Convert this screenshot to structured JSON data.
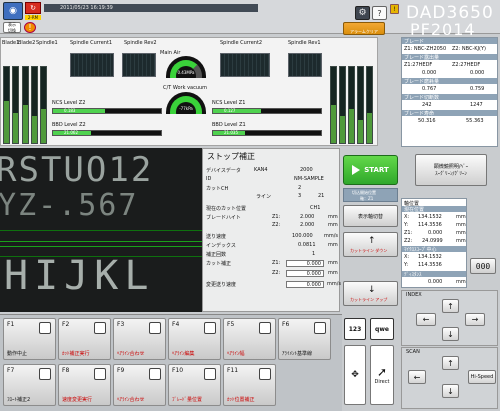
{
  "header": {
    "timestamp": "2011/05/23 16:19:39",
    "alarm_label": "2-RM",
    "dad_title": "DAD3650",
    "pf_title": "PF2014",
    "mini_button_1": "表示",
    "mini_button_2": "切換",
    "alarm_clear_label": "アラームクリア",
    "warn_label": "！"
  },
  "meters": {
    "spindle_names": [
      "Blade1",
      "Blade2",
      "Spindle Current1",
      "Spindle Rev2",
      "Spindle Current2",
      "Spindle Rev1",
      "NCS Level",
      "NCS Level2",
      "BBD Level"
    ],
    "titles": {
      "bh1": "Blade1",
      "bh2": "Blade2",
      "sp1": "Spindle1",
      "sc1": "Spindle Current1",
      "sr2": "Spindle Rev2",
      "air": "Main Air",
      "sc2": "Spindle Current2",
      "sr1": "Spindle Rev1",
      "cwt": "C/T Work vacuum",
      "ncs2": "NCS Level Z2",
      "ncs1": "NCS Level Z1",
      "bbd2": "BBD Level Z2",
      "bbd1": "BBD Level Z1",
      "gauge_top": "0.43MPa",
      "gauge_bot": "-77kPa"
    },
    "bbd_value_left": "21.062",
    "bbd_value_right": "21.035",
    "ncs_value_left": "0.183",
    "ncs_value_right": "0.127"
  },
  "main_panel": {
    "title": "ストップ補正",
    "device_data_label": "デバイスデータ",
    "device_data_value": "KAN4",
    "device_data_count": "2000",
    "id_label": "ID",
    "id_value": "NM-SAMPLE",
    "cut_ch_label": "カットCH",
    "ch_label": "ライン",
    "ch_value": "2",
    "line_value": "3",
    "line_total": "21",
    "current_ch": "CH1",
    "pos_label": "現在のカット位置",
    "blade_height_label": "ブレードハイト",
    "z1": "Z1:",
    "z2": "Z2:",
    "z1_blade_height": "2.000",
    "z2_blade_height": "2.000",
    "feed_speed_label": "送り速度",
    "feed_speed_value": "100.000",
    "unit_feed": "mm/s",
    "index_label": "インデックス",
    "index_value": "0.0811",
    "unit_mm": "mm",
    "repeat_label": "補正回数",
    "repeat_value": "1",
    "offset_label": "カット補正",
    "offset_z1": "0.000",
    "offset_z2": "0.000",
    "change_speed_label": "変更送り速度",
    "change_speed_value": "0.000",
    "unit_speed2": "mm/s"
  },
  "side_buttons": {
    "start": "START",
    "start_hint": "切込開始位置",
    "cut_hint_axis": "軸：Z1",
    "display_toggle": "表示軸切替",
    "cutline_down": "カットライン ダウン",
    "cutline_up": "カットライン アップ"
  },
  "right_panel": {
    "sec_blade": "ブレード",
    "blade_z1": "Z1: NBC-ZH2050",
    "blade_z2": "Z2: NBC-KJ(Y)",
    "sec_exposure": "ブレード露出量",
    "z1_id": "Z1:27HEDF",
    "z2_id": "Z2:27HEDF",
    "exp_z1": "0.000",
    "exp_z2": "0.000",
    "sec_wear": "ブレード磨耗量",
    "wear_z1": "0.767",
    "wear_z2": "0.759",
    "sec_cutcount": "ブレード切断数",
    "cut_z1": "242",
    "cut_z2": "1247",
    "sec_life": "ブレード寿命",
    "life_z1": "50.316",
    "life_z2": "55.363",
    "unit_mm": "mm",
    "unit_line": "本"
  },
  "microscope_btn": {
    "line1": "顕微鏡照明/ﾍﾞｰ",
    "line2": "ｽｰｸﾞﾘｰﾝ/ｸﾞﾘｰﾝ"
  },
  "axis_panel": {
    "title": "軸位置",
    "sec_current": "現在位置",
    "x_label": "X:",
    "x_value": "134.1532",
    "y_label": "Y:",
    "y_value": "114.3536",
    "z1_label": "Z1:",
    "z1_value": "0.000",
    "z2_label": "Z2:",
    "z2_value": "24.0999",
    "sec_mic": "ﾏｲｸﾛｽｺｰﾌﾟ中心",
    "mx_value": "134.1532",
    "my_value": "114.3536",
    "sec_offset": "ﾃﾞｨｽﾀﾝｽ",
    "off_value": "0.000",
    "unit": "mm",
    "counter": "000"
  },
  "index_panel": {
    "title": "INDEX"
  },
  "scan_panel": {
    "title": "SCAN",
    "hi_speed": "Hi-Speed"
  },
  "fkeys": [
    {
      "key": "F1",
      "label": "動作中止",
      "dark": true
    },
    {
      "key": "F2",
      "label": "ｶｯﾄ補正実行",
      "dark": false
    },
    {
      "key": "F3",
      "label": "ﾍｱﾗｲﾝ合わせ",
      "dark": false
    },
    {
      "key": "F4",
      "label": "ﾍｱﾗｲﾝ編集",
      "dark": false
    },
    {
      "key": "F5",
      "label": "ﾍｱﾗｲﾝ幅",
      "dark": false
    },
    {
      "key": "F6",
      "label": "ｱﾗｲﾒﾝﾄ基準線",
      "dark": true
    },
    {
      "key": "F7",
      "label": "ﾌﾛｰﾄ補正2",
      "dark": true
    },
    {
      "key": "F8",
      "label": "速度変更実行",
      "dark": false
    },
    {
      "key": "F9",
      "label": "ﾍｱﾗｲﾝ合わせ",
      "dark": false
    },
    {
      "key": "F10",
      "label": "ﾌﾞﾚｰﾄﾞ量位置",
      "dark": false
    },
    {
      "key": "F11",
      "label": "ｶｯﾄ位置補正",
      "dark": false
    }
  ],
  "bottom_right": {
    "btn_123": "123",
    "btn_qwe": "qwe",
    "btn_direct": "Direct"
  },
  "colors": {
    "accent_green": "#3ec23e",
    "header_dark": "#3b4149",
    "section_blue": "#8ea3b6"
  }
}
